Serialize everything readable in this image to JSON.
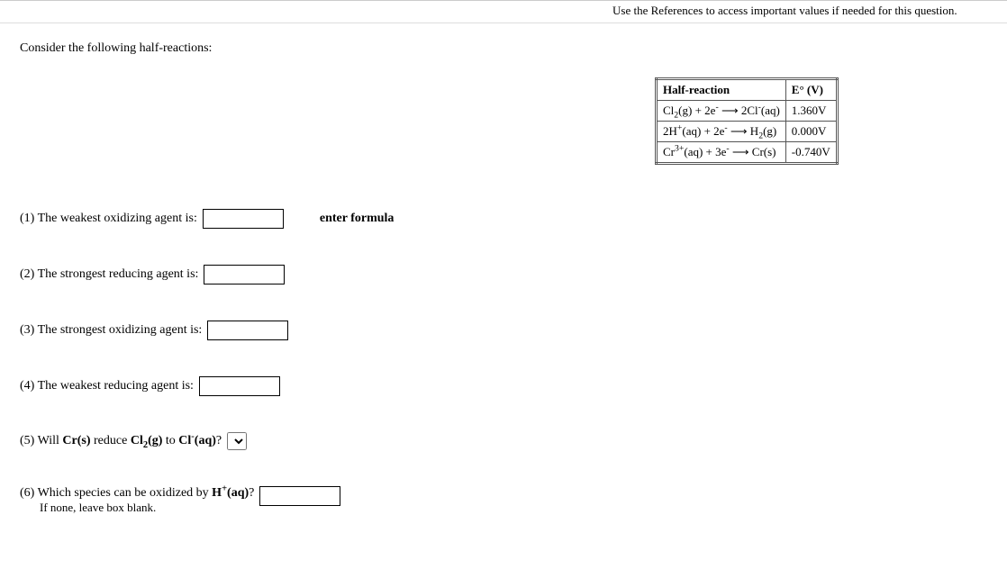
{
  "top_note": "Use the References to access important values if needed for this question.",
  "intro": "Consider the following half-reactions:",
  "table": {
    "header_reaction": "Half-reaction",
    "header_potential": "E° (V)",
    "rows": [
      {
        "reaction_html": "Cl<sub>2</sub>(g) + 2e<sup>-</sup> ⟶ 2Cl<sup>-</sup>(aq)",
        "potential": "1.360V"
      },
      {
        "reaction_html": "2H<sup>+</sup>(aq) + 2e<sup>-</sup> ⟶ H<sub>2</sub>(g)",
        "potential": "0.000V"
      },
      {
        "reaction_html": "Cr<sup>3+</sup>(aq) + 3e<sup>-</sup> ⟶ Cr(s)",
        "potential": "-0.740V"
      }
    ]
  },
  "questions": {
    "q1": "(1) The weakest oxidizing agent is:",
    "q1_hint": "enter formula",
    "q2": "(2) The strongest reducing agent is:",
    "q3": "(3) The strongest oxidizing agent is:",
    "q4": "(4) The weakest reducing agent is:",
    "q5_html": "(5) Will <b>Cr(s)</b> reduce <b>Cl<sub>2</sub>(g)</b> to <b>Cl<sup>-</sup>(aq)</b>?",
    "q6_html": "(6) Which species can be oxidized by <b>H<sup>+</sup>(aq)</b>?",
    "q6_sub": "If none, leave box blank."
  }
}
